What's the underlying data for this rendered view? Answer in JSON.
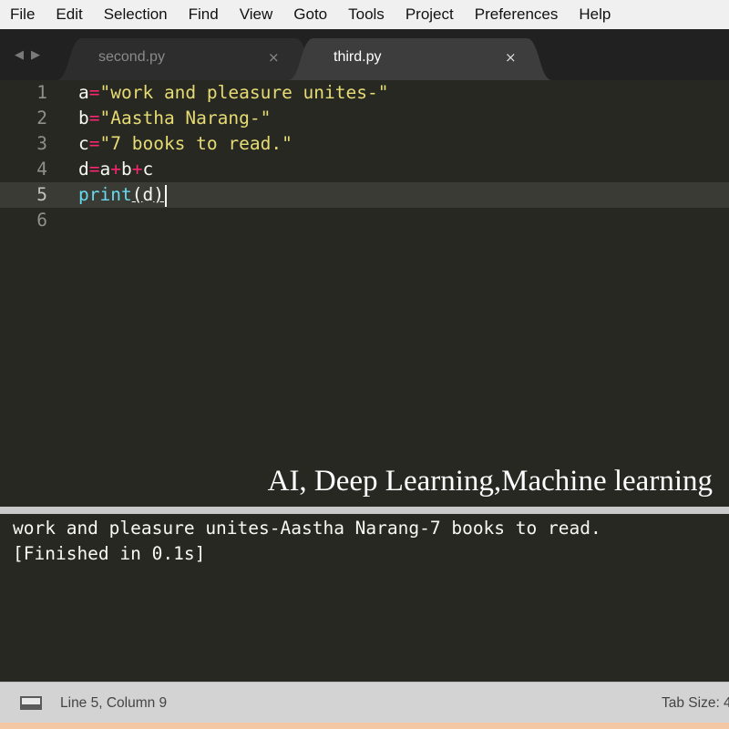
{
  "menu": [
    "File",
    "Edit",
    "Selection",
    "Find",
    "View",
    "Goto",
    "Tools",
    "Project",
    "Preferences",
    "Help"
  ],
  "nav": {
    "back_glyph": "◀",
    "forward_glyph": "▶"
  },
  "tabs": [
    {
      "label": "second.py",
      "close": "×",
      "active": false
    },
    {
      "label": "third.py",
      "close": "×",
      "active": true
    }
  ],
  "editor": {
    "line_numbers": [
      "1",
      "2",
      "3",
      "4",
      "5",
      "6"
    ],
    "active_line": 5,
    "lines": [
      {
        "var": "a",
        "eq": "=",
        "str": "\"work and pleasure unites-\""
      },
      {
        "var": "b",
        "eq": "=",
        "str": "\"Aastha Narang-\""
      },
      {
        "var": "c",
        "eq": "=",
        "str": "\"7 books to read.\""
      },
      {
        "d": "d",
        "eq": "=",
        "a": "a",
        "plus1": "+",
        "b": "b",
        "plus2": "+",
        "c": "c"
      },
      {
        "fn": "print",
        "open": "(",
        "arg": "d",
        "close": ")"
      }
    ]
  },
  "watermark": "AI, Deep Learning,Machine learning",
  "output": {
    "line1": "work and pleasure unites-Aastha Narang-7 books to read.",
    "line2": "[Finished in 0.1s]"
  },
  "status": {
    "position": "Line 5, Column 9",
    "tab_size": "Tab Size: 4"
  },
  "colors": {
    "editor_bg": "#272822",
    "string": "#e6db74",
    "operator": "#f92672",
    "function": "#66d9ef",
    "frame": "#f3c7a3"
  }
}
